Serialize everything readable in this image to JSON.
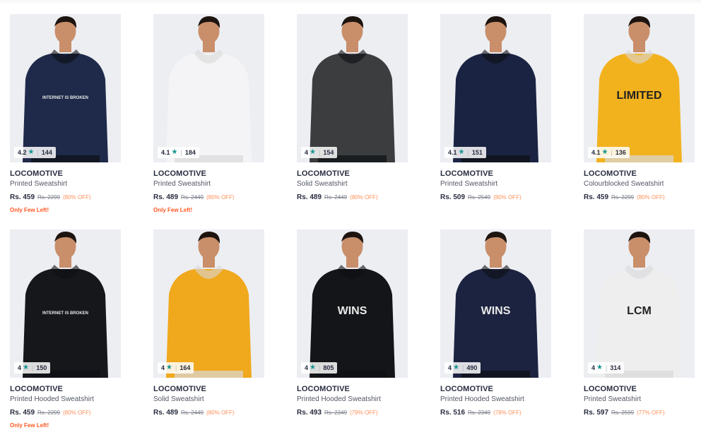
{
  "products": [
    {
      "rating": "4.2",
      "count": "144",
      "brand": "LOCOMOTIVE",
      "title": "Printed Sweatshirt",
      "price": "Rs. 459",
      "mrp": "Rs. 2299",
      "discount": "(80% OFF)",
      "badge": "Only Few Left!",
      "color": "#1f2a4a",
      "print": "INTERNET IS BROKEN"
    },
    {
      "rating": "4.1",
      "count": "184",
      "brand": "LOCOMOTIVE",
      "title": "Printed Sweatshirt",
      "price": "Rs. 489",
      "mrp": "Rs. 2449",
      "discount": "(80% OFF)",
      "badge": "Only Few Left!",
      "color": "#f4f4f6",
      "print": ""
    },
    {
      "rating": "4",
      "count": "154",
      "brand": "LOCOMOTIVE",
      "title": "Solid Sweatshirt",
      "price": "Rs. 489",
      "mrp": "Rs. 2449",
      "discount": "(80% OFF)",
      "badge": "",
      "color": "#3b3d3f",
      "print": ""
    },
    {
      "rating": "4.1",
      "count": "151",
      "brand": "LOCOMOTIVE",
      "title": "Printed Sweatshirt",
      "price": "Rs. 509",
      "mrp": "Rs. 2549",
      "discount": "(80% OFF)",
      "badge": "",
      "color": "#1b2342",
      "print": ""
    },
    {
      "rating": "4.1",
      "count": "136",
      "brand": "LOCOMOTIVE",
      "title": "Colourblocked Sweatshirt",
      "price": "Rs. 459",
      "mrp": "Rs. 2299",
      "discount": "(80% OFF)",
      "badge": "",
      "color": "#f2b21e",
      "print": "LIMITED"
    },
    {
      "rating": "4",
      "count": "150",
      "brand": "LOCOMOTIVE",
      "title": "Printed Hooded Sweatshirt",
      "price": "Rs. 459",
      "mrp": "Rs. 2299",
      "discount": "(80% OFF)",
      "badge": "Only Few Left!",
      "color": "#16171b",
      "print": "INTERNET IS BROKEN"
    },
    {
      "rating": "4",
      "count": "164",
      "brand": "LOCOMOTIVE",
      "title": "Solid Sweatshirt",
      "price": "Rs. 489",
      "mrp": "Rs. 2449",
      "discount": "(80% OFF)",
      "badge": "",
      "color": "#f0a81c",
      "print": ""
    },
    {
      "rating": "4",
      "count": "805",
      "brand": "LOCOMOTIVE",
      "title": "Printed Hooded Sweatshirt",
      "price": "Rs. 493",
      "mrp": "Rs. 2349",
      "discount": "(79% OFF)",
      "badge": "",
      "color": "#141518",
      "print": "WINS"
    },
    {
      "rating": "4",
      "count": "490",
      "brand": "LOCOMOTIVE",
      "title": "Printed Hooded Sweatshirt",
      "price": "Rs. 516",
      "mrp": "Rs. 2349",
      "discount": "(78% OFF)",
      "badge": "",
      "color": "#1c2340",
      "print": "WINS"
    },
    {
      "rating": "4",
      "count": "314",
      "brand": "LOCOMOTIVE",
      "title": "Printed Sweatshirt",
      "price": "Rs. 597",
      "mrp": "Rs. 2599",
      "discount": "(77% OFF)",
      "badge": "",
      "color": "#eeeeef",
      "print": "LCM"
    }
  ]
}
